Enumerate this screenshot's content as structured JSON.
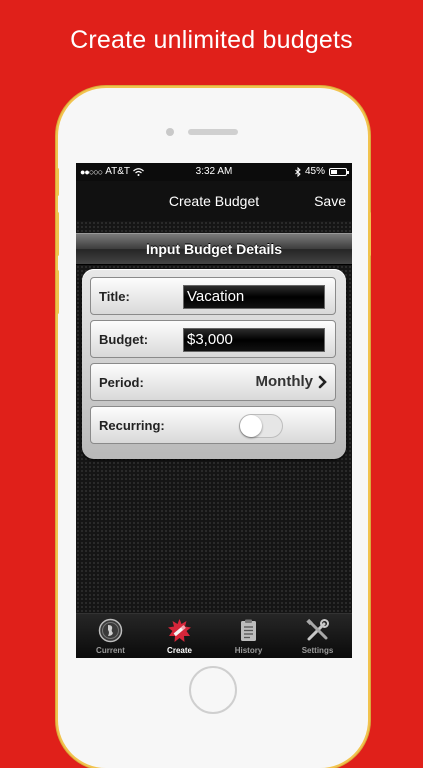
{
  "promo": {
    "headline": "Create unlimited budgets"
  },
  "status_bar": {
    "signal": "●●○○○",
    "carrier": "AT&T",
    "time": "3:32 AM",
    "battery": "45%",
    "battery_level": 0.45
  },
  "nav": {
    "title": "Create Budget",
    "save_label": "Save"
  },
  "section": {
    "header": "Input Budget Details"
  },
  "form": {
    "title_label": "Title:",
    "title_value": "Vacation",
    "budget_label": "Budget:",
    "budget_value": "$3,000",
    "period_label": "Period:",
    "period_value": "Monthly",
    "recurring_label": "Recurring:",
    "recurring_on": false
  },
  "tabs": [
    {
      "label": "Current",
      "icon": "coin-icon"
    },
    {
      "label": "Create",
      "icon": "pencil-starburst-icon",
      "active": true
    },
    {
      "label": "History",
      "icon": "clipboard-icon"
    },
    {
      "label": "Settings",
      "icon": "tools-icon"
    }
  ],
  "colors": {
    "background": "#e0201a",
    "phone_gold": "#f2c34e",
    "accent_create": "#d6263a"
  }
}
